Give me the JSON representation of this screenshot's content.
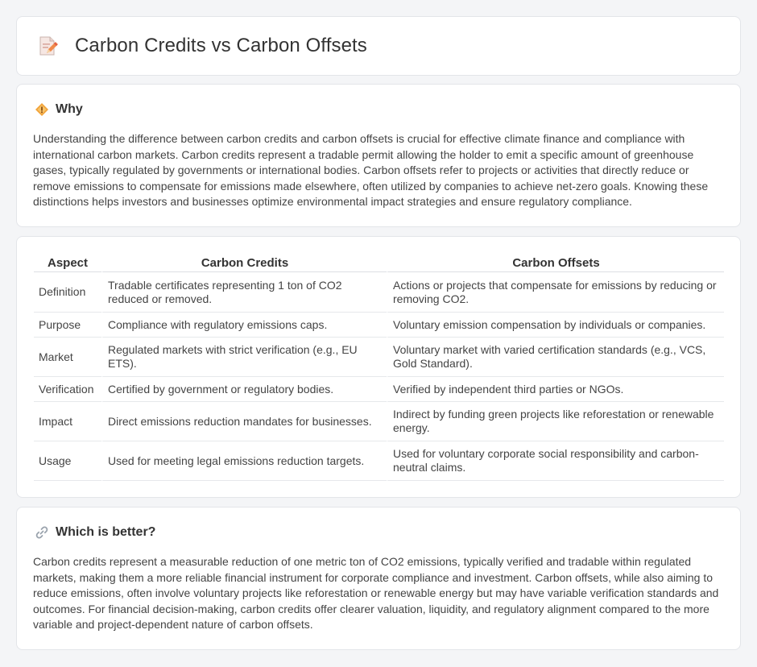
{
  "header": {
    "title": "Carbon Credits vs Carbon Offsets",
    "icon": "document-pencil-icon"
  },
  "why": {
    "icon": "diamond-warning-icon",
    "title": "Why",
    "text": "Understanding the difference between carbon credits and carbon offsets is crucial for effective climate finance and compliance with international carbon markets. Carbon credits represent a tradable permit allowing the holder to emit a specific amount of greenhouse gases, typically regulated by governments or international bodies. Carbon offsets refer to projects or activities that directly reduce or remove emissions to compensate for emissions made elsewhere, often utilized by companies to achieve net-zero goals. Knowing these distinctions helps investors and businesses optimize environmental impact strategies and ensure regulatory compliance."
  },
  "comparison": {
    "headers": [
      "Aspect",
      "Carbon Credits",
      "Carbon Offsets"
    ],
    "rows": [
      {
        "aspect": "Definition",
        "credits": "Tradable certificates representing 1 ton of CO2 reduced or removed.",
        "offsets": "Actions or projects that compensate for emissions by reducing or removing CO2."
      },
      {
        "aspect": "Purpose",
        "credits": "Compliance with regulatory emissions caps.",
        "offsets": "Voluntary emission compensation by individuals or companies."
      },
      {
        "aspect": "Market",
        "credits": "Regulated markets with strict verification (e.g., EU ETS).",
        "offsets": "Voluntary market with varied certification standards (e.g., VCS, Gold Standard)."
      },
      {
        "aspect": "Verification",
        "credits": "Certified by government or regulatory bodies.",
        "offsets": "Verified by independent third parties or NGOs."
      },
      {
        "aspect": "Impact",
        "credits": "Direct emissions reduction mandates for businesses.",
        "offsets": "Indirect by funding green projects like reforestation or renewable energy."
      },
      {
        "aspect": "Usage",
        "credits": "Used for meeting legal emissions reduction targets.",
        "offsets": "Used for voluntary corporate social responsibility and carbon-neutral claims."
      }
    ]
  },
  "better": {
    "icon": "link-icon",
    "title": "Which is better?",
    "text": "Carbon credits represent a measurable reduction of one metric ton of CO2 emissions, typically verified and tradable within regulated markets, making them a more reliable financial instrument for corporate compliance and investment. Carbon offsets, while also aiming to reduce emissions, often involve voluntary projects like reforestation or renewable energy but may have variable verification standards and outcomes. For financial decision-making, carbon credits offer clearer valuation, liquidity, and regulatory alignment compared to the more variable and project-dependent nature of carbon offsets."
  },
  "colors": {
    "page_bg": "#f4f5f7",
    "card_bg": "#ffffff",
    "accent_orange": "#f0a030",
    "icon_pink": "#e8736b"
  }
}
